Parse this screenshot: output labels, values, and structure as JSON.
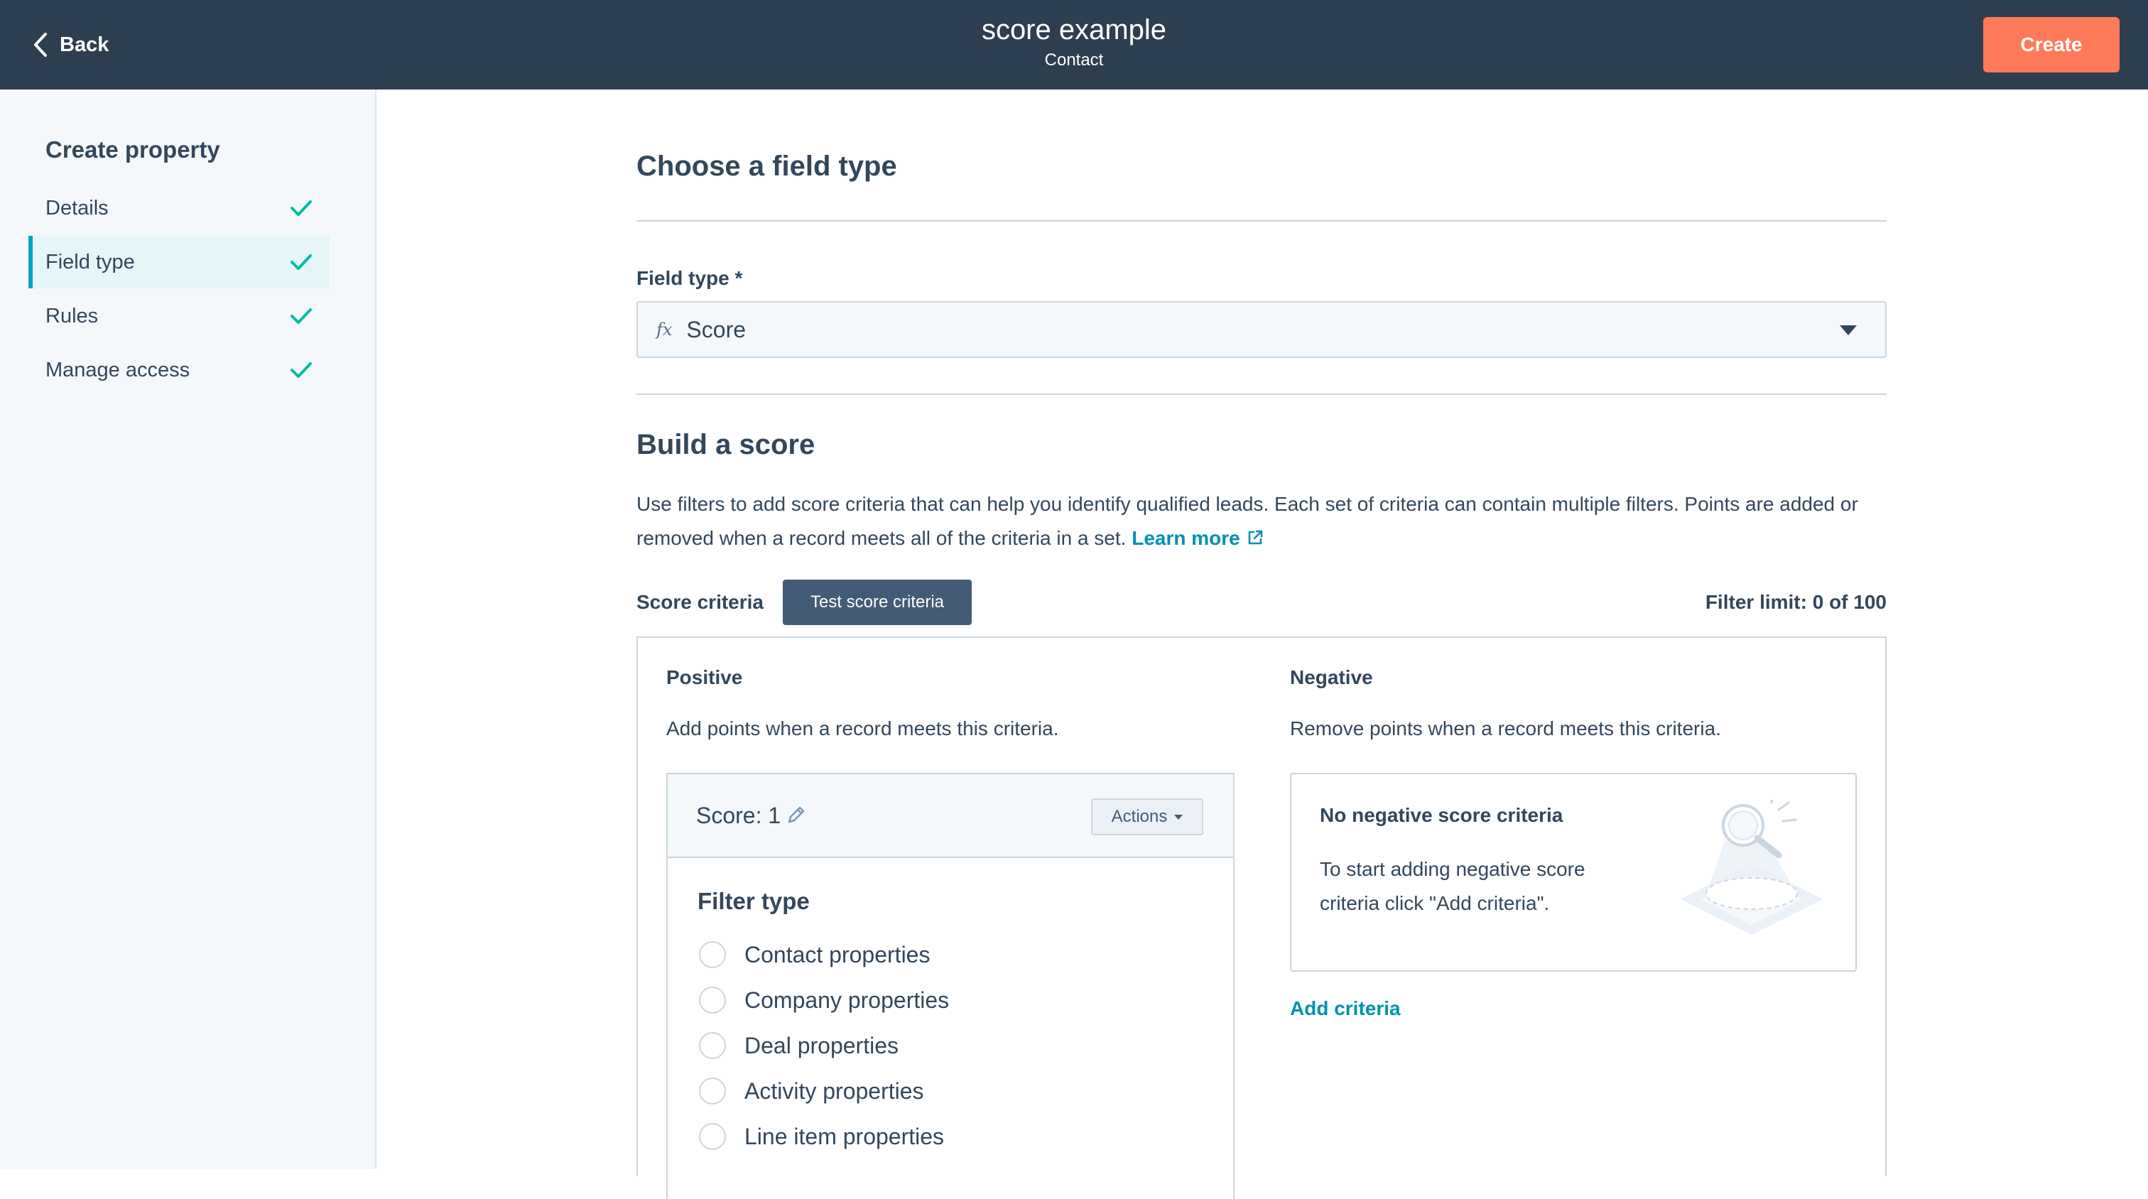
{
  "header": {
    "back_label": "Back",
    "title": "score example",
    "subtitle": "Contact",
    "create_label": "Create"
  },
  "sidebar": {
    "heading": "Create property",
    "steps": [
      {
        "label": "Details",
        "complete": true,
        "active": false
      },
      {
        "label": "Field type",
        "complete": true,
        "active": true
      },
      {
        "label": "Rules",
        "complete": true,
        "active": false
      },
      {
        "label": "Manage access",
        "complete": true,
        "active": false
      }
    ]
  },
  "main": {
    "field_type_section_title": "Choose a field type",
    "field_type_label": "Field type *",
    "field_type_icon": "fx",
    "field_type_value": "Score",
    "build_title": "Build a score",
    "description": "Use filters to add score criteria that can help you identify qualified leads. Each set of criteria can contain multiple filters. Points are added or removed when a record meets all of the criteria in a set.",
    "learn_more": "Learn more",
    "score_criteria_label": "Score criteria",
    "test_button": "Test score criteria",
    "filter_limit": "Filter limit: 0 of 100",
    "positive": {
      "title": "Positive",
      "description": "Add points when a record meets this criteria.",
      "score_label": "Score: 1",
      "actions_label": "Actions",
      "filter_type_title": "Filter type",
      "filter_options": [
        "Contact properties",
        "Company properties",
        "Deal properties",
        "Activity properties",
        "Line item properties"
      ]
    },
    "negative": {
      "title": "Negative",
      "description": "Remove points when a record meets this criteria.",
      "empty_title": "No negative score criteria",
      "empty_text": "To start adding negative score criteria click \"Add criteria\".",
      "add_criteria": "Add criteria"
    }
  },
  "colors": {
    "header_bg": "#2d3e50",
    "create_button": "#ff7a59",
    "accent_teal": "#00a4bd",
    "link": "#0091ae",
    "check_green": "#00bda5",
    "test_button": "#425b76"
  }
}
